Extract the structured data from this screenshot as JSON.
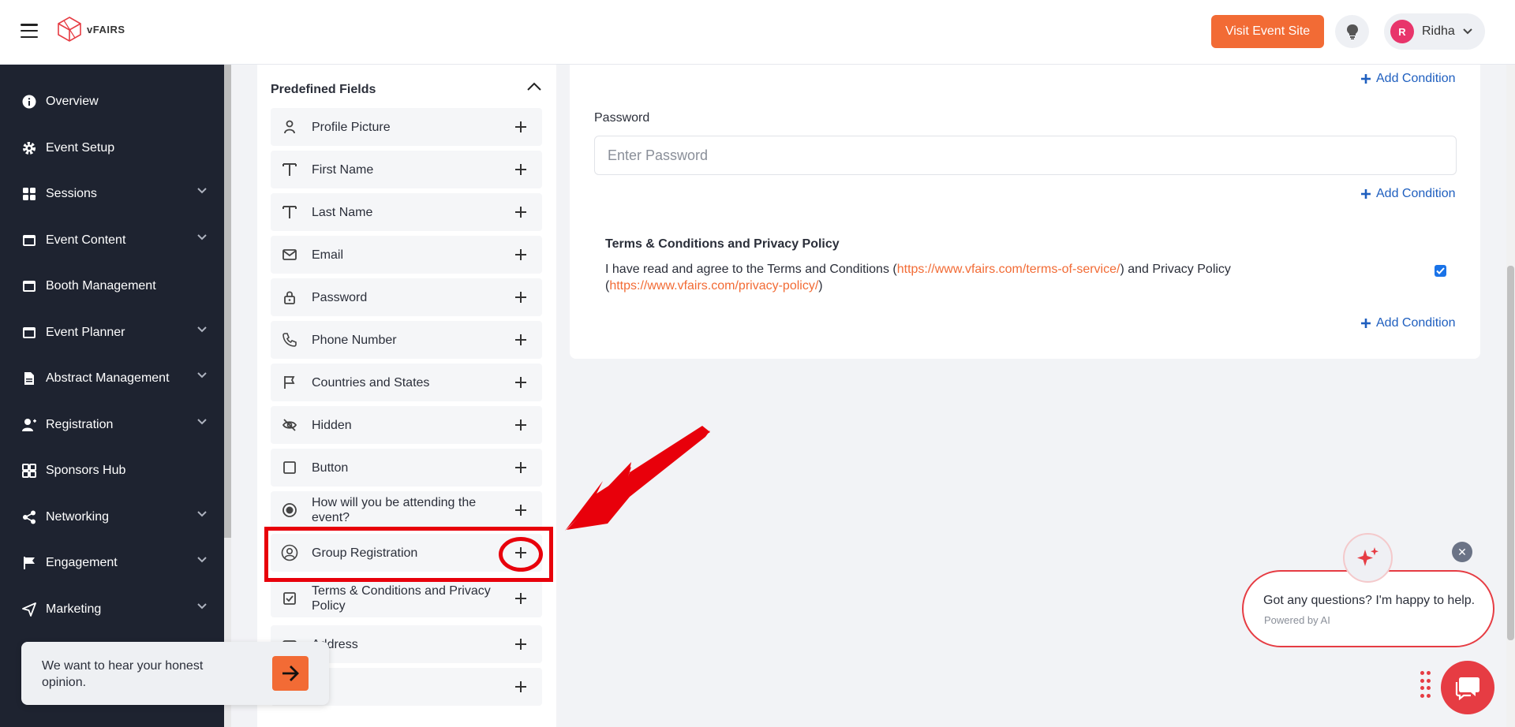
{
  "header": {
    "brand": "vFAIRS",
    "visit_button": "Visit Event Site",
    "user": {
      "initial": "R",
      "name": "Ridha"
    }
  },
  "sidebar": {
    "items": [
      {
        "label": "Overview",
        "icon": "info-icon",
        "expandable": false
      },
      {
        "label": "Event Setup",
        "icon": "gear-icon",
        "expandable": false
      },
      {
        "label": "Sessions",
        "icon": "grid-icon",
        "expandable": true
      },
      {
        "label": "Event Content",
        "icon": "window-icon",
        "expandable": true
      },
      {
        "label": "Booth Management",
        "icon": "window-icon",
        "expandable": false
      },
      {
        "label": "Event Planner",
        "icon": "calendar-icon",
        "expandable": true
      },
      {
        "label": "Abstract Management",
        "icon": "document-icon",
        "expandable": true
      },
      {
        "label": "Registration",
        "icon": "user-plus-icon",
        "expandable": true
      },
      {
        "label": "Sponsors Hub",
        "icon": "apps-icon",
        "expandable": false
      },
      {
        "label": "Networking",
        "icon": "share-icon",
        "expandable": true
      },
      {
        "label": "Engagement",
        "icon": "flag-icon",
        "expandable": true
      },
      {
        "label": "Marketing",
        "icon": "send-icon",
        "expandable": true
      }
    ]
  },
  "fields_panel": {
    "title": "Predefined Fields",
    "fields": [
      {
        "label": "Profile Picture",
        "icon": "person-icon"
      },
      {
        "label": "First Name",
        "icon": "text-icon"
      },
      {
        "label": "Last Name",
        "icon": "text-icon"
      },
      {
        "label": "Email",
        "icon": "mail-icon"
      },
      {
        "label": "Password",
        "icon": "lock-icon"
      },
      {
        "label": "Phone Number",
        "icon": "phone-icon"
      },
      {
        "label": "Countries and States",
        "icon": "flag-icon"
      },
      {
        "label": "Hidden",
        "icon": "eye-off-icon"
      },
      {
        "label": "Button",
        "icon": "square-icon"
      },
      {
        "label": "How will you be attending the event?",
        "icon": "radio-icon"
      },
      {
        "label": "Group Registration",
        "icon": "user-circle-icon"
      },
      {
        "label": "Terms & Conditions and Privacy Policy",
        "icon": "checkbox-icon"
      },
      {
        "label": "Address",
        "icon": "address-icon"
      },
      {
        "label": "",
        "icon": ""
      }
    ]
  },
  "form": {
    "add_condition": "Add Condition",
    "password_label": "Password",
    "password_placeholder": "Enter Password",
    "tc_title": "Terms & Conditions and Privacy Policy",
    "tc_text_1": "I have read and agree to the Terms and Conditions (",
    "tc_link_1": "https://www.vfairs.com/terms-of-service/",
    "tc_text_2": ") and Privacy Policy (",
    "tc_link_2": "https://www.vfairs.com/privacy-policy/",
    "tc_text_3": ")",
    "tc_checked": true
  },
  "feedback": {
    "text": "We want to hear your honest opinion."
  },
  "ai_chat": {
    "message": "Got any questions? I'm happy to help.",
    "sub": "Powered by AI"
  },
  "colors": {
    "accent": "#f26b35",
    "sidebar_bg": "#1e2330",
    "link": "#1f5fbf",
    "highlight": "#e8000b",
    "chat": "#e63c43"
  }
}
